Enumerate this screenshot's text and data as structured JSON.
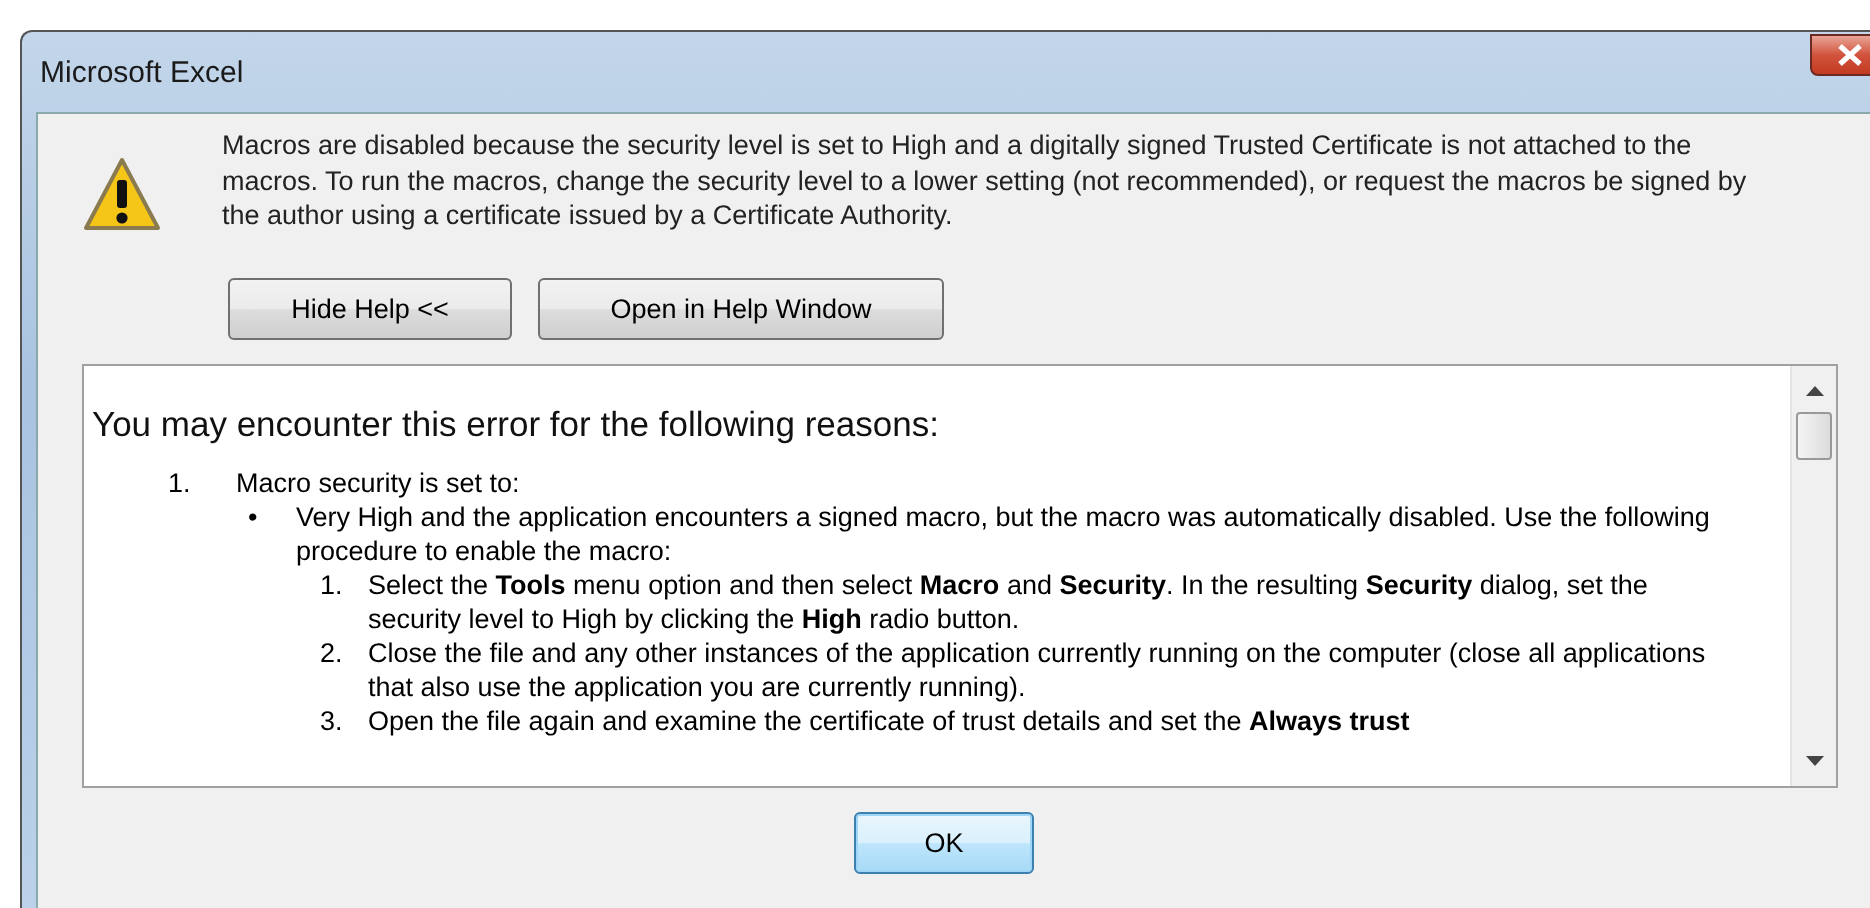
{
  "window": {
    "title": "Microsoft Excel"
  },
  "message": "Macros are disabled because the security level is set to High and a digitally signed Trusted Certificate is not attached to the macros. To run the macros, change the security level to a lower setting (not recommended), or request the macros be signed by the author using a certificate issued by a Certificate Authority.",
  "buttons": [
    "Hide Help <<",
    "Open in Help Window"
  ],
  "help": {
    "heading": "You may encounter this error for the following reasons:",
    "items": [
      {
        "marker": "1.",
        "text": "Macro security is set to:",
        "children": [
          {
            "marker": "•",
            "text": "Very High and the application encounters a signed macro, but the macro was automatically disabled. Use the following procedure to enable the macro:",
            "children": [
              {
                "marker": "1.",
                "text": "Select the **Tools** menu option and then select **Macro** and **Security**. In the resulting **Security** dialog, set the security level to High by clicking the **High** radio button."
              },
              {
                "marker": "2.",
                "text": "Close the file and any other instances of the application currently running on the computer (close all applications that also use the application you are currently running)."
              },
              {
                "marker": "3.",
                "text": "Open the file again and examine the certificate of trust details and set the **Always trust**"
              }
            ]
          }
        ]
      }
    ]
  },
  "ok": "OK"
}
